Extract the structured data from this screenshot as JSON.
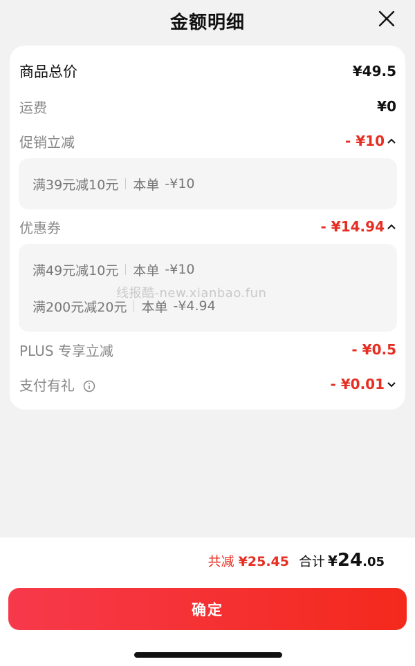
{
  "header": {
    "title": "金额明细"
  },
  "rows": {
    "goods_total": {
      "label": "商品总价",
      "value": "¥49.5"
    },
    "shipping": {
      "label": "运费",
      "value": "¥0"
    },
    "promo": {
      "label": "促销立减",
      "value": "- ¥10"
    },
    "coupon": {
      "label": "优惠券",
      "value": "- ¥14.94"
    },
    "plus": {
      "label": "PLUS 专享立减",
      "value": "- ¥0.5"
    },
    "pay_gift": {
      "label": "支付有礼",
      "value": "- ¥0.01"
    }
  },
  "promo_details": [
    {
      "name": "满39元减10元",
      "order": "本单",
      "amount": "-¥10"
    }
  ],
  "coupon_details": [
    {
      "name": "满49元减10元",
      "order": "本单",
      "amount": "-¥10"
    },
    {
      "name": "满200元减20元",
      "order": "本单",
      "amount": "-¥4.94"
    }
  ],
  "watermark": "线报酷-new.xianbao.fun",
  "summary": {
    "reduce_label": "共减",
    "reduce_value": "¥25.45",
    "total_label": "合计",
    "total_currency": "¥",
    "total_int": "24",
    "total_dec": ".05"
  },
  "confirm_label": "确定",
  "colors": {
    "accent_red": "#e62e22",
    "button_start": "#f6394b",
    "button_end": "#f4291c"
  }
}
